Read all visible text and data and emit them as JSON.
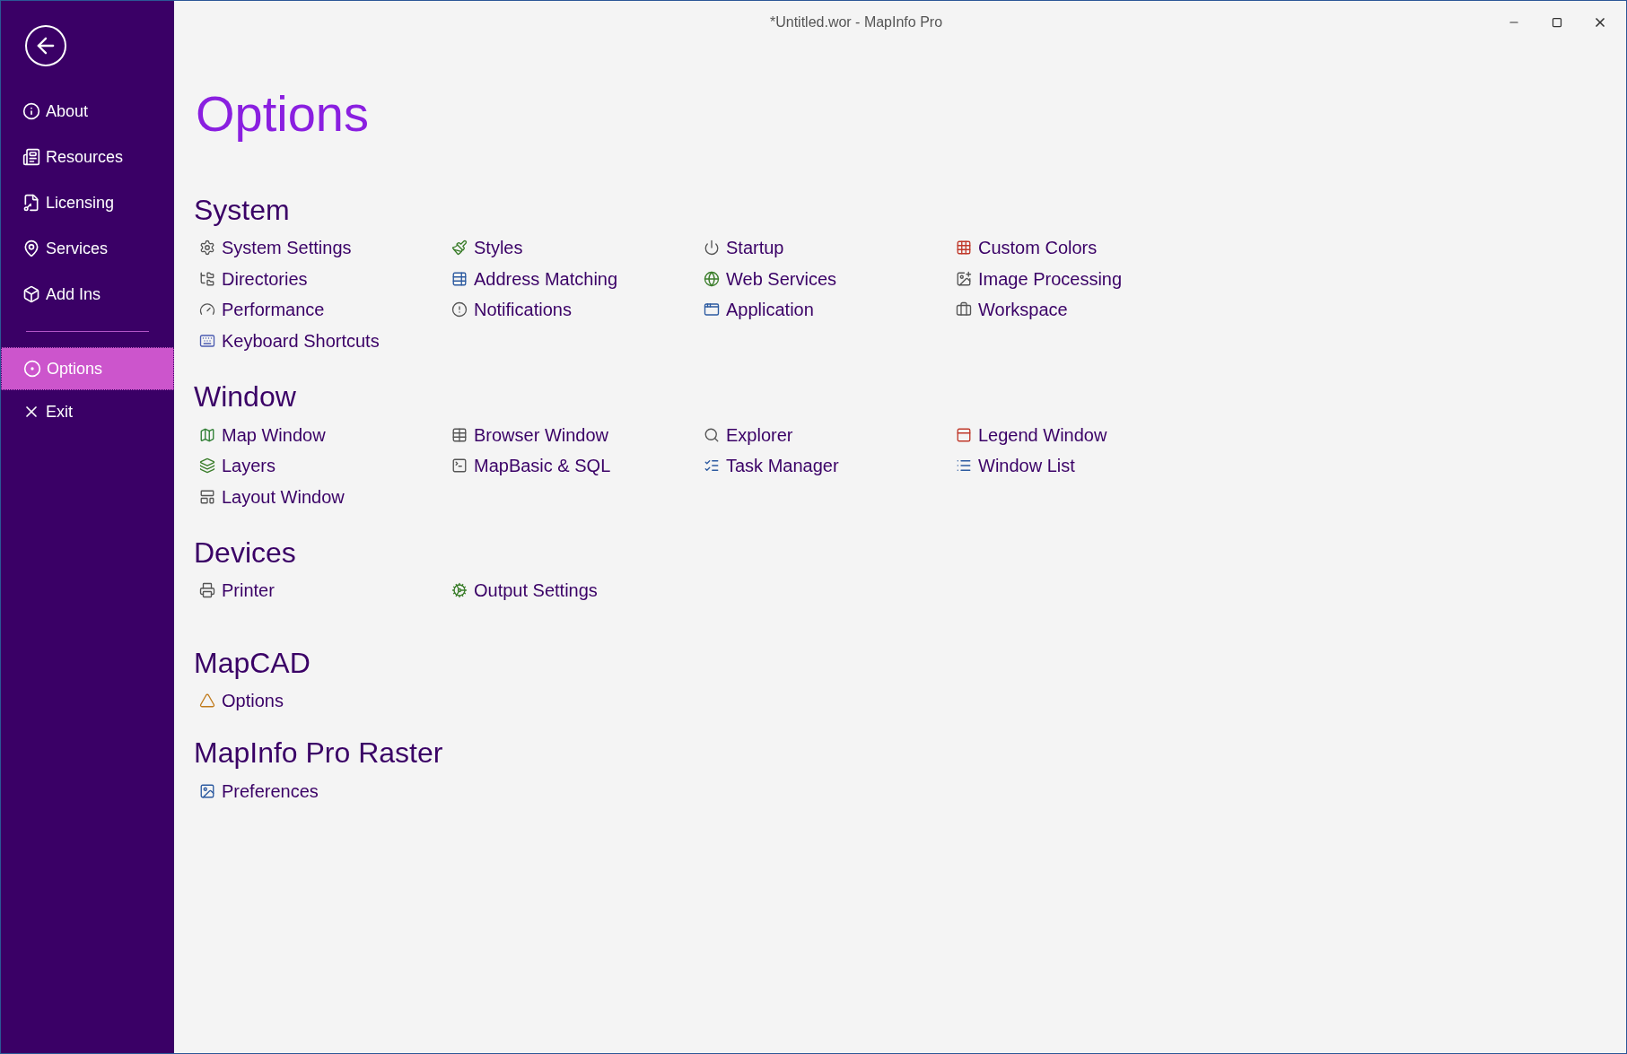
{
  "window": {
    "title": "*Untitled.wor - MapInfo Pro"
  },
  "sidebar": {
    "items": [
      {
        "label": "About",
        "selected": false
      },
      {
        "label": "Resources",
        "selected": false
      },
      {
        "label": "Licensing",
        "selected": false
      },
      {
        "label": "Services",
        "selected": false
      },
      {
        "label": "Add Ins",
        "selected": false
      },
      {
        "label": "Options",
        "selected": true
      },
      {
        "label": "Exit",
        "selected": false
      }
    ]
  },
  "heading": "Options",
  "sections": [
    {
      "title": "System",
      "items": [
        "System Settings",
        "Styles",
        "Startup",
        "Custom Colors",
        "Directories",
        "Address Matching",
        "Web Services",
        "Image Processing",
        "Performance",
        "Notifications",
        "Application",
        "Workspace",
        "Keyboard Shortcuts"
      ]
    },
    {
      "title": "Window",
      "items": [
        "Map Window",
        "Browser Window",
        "Explorer",
        "Legend Window",
        "Layers",
        "MapBasic & SQL",
        "Task Manager",
        "Window List",
        "Layout Window"
      ]
    },
    {
      "title": "Devices",
      "items": [
        "Printer",
        "Output Settings"
      ]
    },
    {
      "title": "MapCAD",
      "items": [
        "Options"
      ]
    },
    {
      "title": "MapInfo Pro Raster",
      "items": [
        "Preferences"
      ]
    }
  ]
}
